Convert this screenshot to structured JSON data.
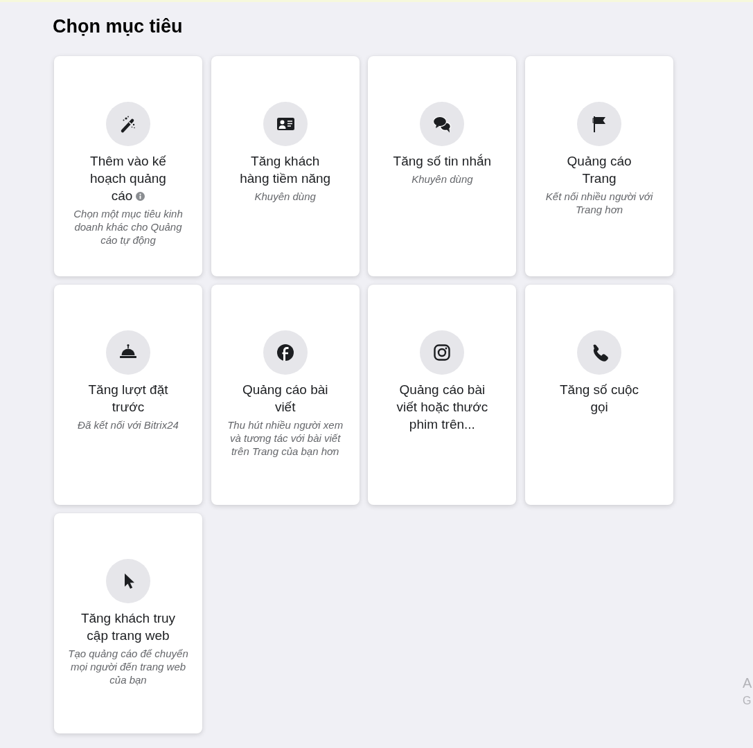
{
  "page": {
    "title": "Chọn mục tiêu"
  },
  "objectives": [
    {
      "kind": "automated",
      "title": "Thêm vào kế hoạch quảng cáo",
      "info": true,
      "description": "Chọn một mục tiêu kinh doanh khác cho Quảng cáo tự động"
    },
    {
      "kind": "leads",
      "title": "Tăng khách hàng tiềm năng",
      "info": false,
      "description": "Khuyên dùng"
    },
    {
      "kind": "messages",
      "title": "Tăng số tin nhắn",
      "info": false,
      "description": "Khuyên dùng"
    },
    {
      "kind": "page",
      "title": "Quảng cáo Trang",
      "info": false,
      "description": "Kết nối nhiều người với Trang hơn"
    },
    {
      "kind": "bookings",
      "title": "Tăng lượt đặt trước",
      "info": false,
      "description": "Đã kết nối với Bitrix24"
    },
    {
      "kind": "post",
      "title": "Quảng cáo bài viết",
      "info": false,
      "description": "Thu hút nhiều người xem và tương tác với bài viết trên Trang của bạn hơn"
    },
    {
      "kind": "video",
      "title": "Quảng cáo bài viết hoặc thước phim trên...",
      "info": false
    },
    {
      "kind": "calls",
      "title": "Tăng số cuộc gọi",
      "info": false
    },
    {
      "kind": "traffic",
      "title": "Tăng khách truy cập trang web",
      "info": false,
      "description": "Tạo quảng cáo để chuyển mọi người đến trang web của bạn"
    }
  ],
  "system_overlay": {
    "lines": [
      "A",
      "G"
    ]
  }
}
